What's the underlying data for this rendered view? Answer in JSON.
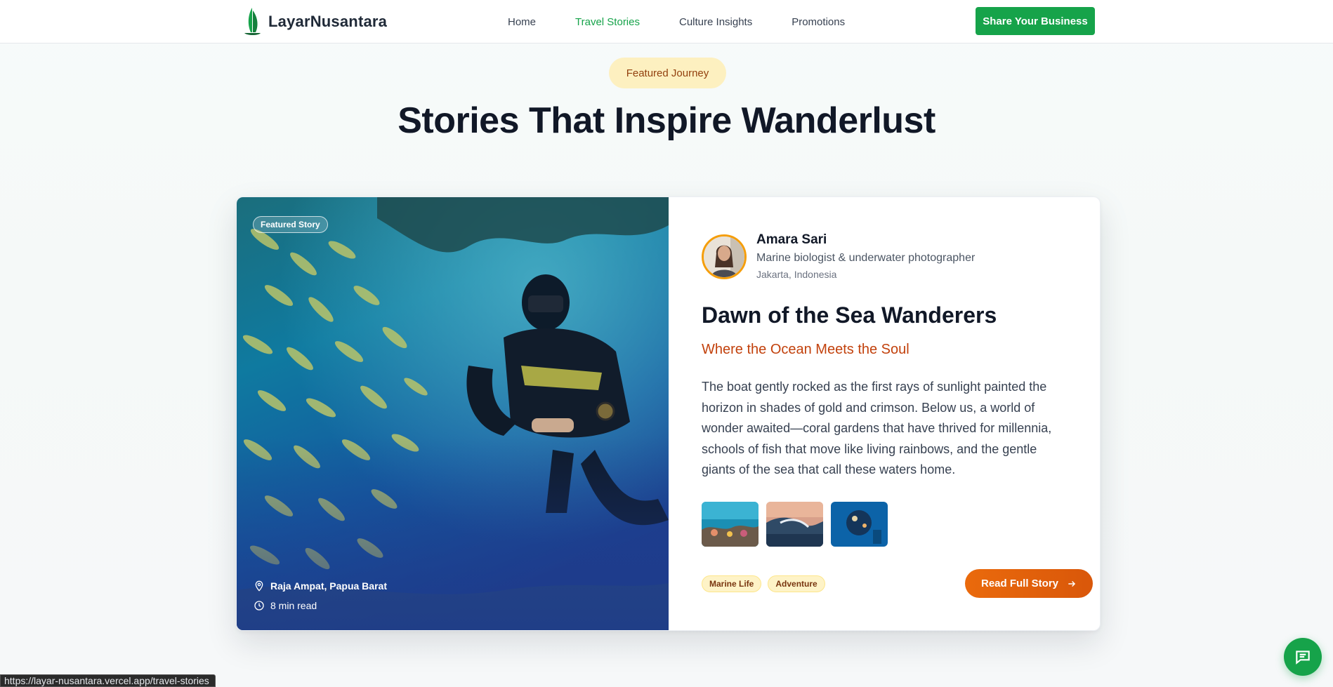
{
  "navbar": {
    "brand": "LayarNusantara",
    "logo_icon": "sailboat-icon",
    "links": [
      {
        "label": "Home",
        "active": false
      },
      {
        "label": "Travel Stories",
        "active": true
      },
      {
        "label": "Culture Insights",
        "active": false
      },
      {
        "label": "Promotions",
        "active": false
      }
    ],
    "cta_label": "Share Your Business"
  },
  "hero": {
    "pill": "Featured Journey",
    "title": "Stories That Inspire Wanderlust"
  },
  "featured_story": {
    "image_badge": "Featured Story",
    "location": "Raja Ampat, Papua Barat",
    "location_icon": "map-pin-icon",
    "read_time": "8 min read",
    "read_time_icon": "clock-icon",
    "author": {
      "name": "Amara Sari",
      "role": "Marine biologist & underwater photographer",
      "location": "Jakarta, Indonesia"
    },
    "title": "Dawn of the Sea Wanderers",
    "subtitle": "Where the Ocean Meets the Soul",
    "excerpt": "The boat gently rocked as the first rays of sunlight painted the horizon in shades of gold and crimson. Below us, a world of wonder awaited—coral gardens that have thrived for millennia, schools of fish that move like living rainbows, and the gentle giants of the sea that call these waters home.",
    "thumbnails": [
      "coral-reef-thumbnail",
      "ocean-wave-thumbnail",
      "diver-reef-thumbnail"
    ],
    "tags": [
      "Marine Life",
      "Adventure"
    ],
    "read_more_label": "Read Full Story",
    "read_more_icon": "arrow-right-icon"
  },
  "chat_icon": "chat-bubble-icon",
  "status_bar_url": "https://layar-nusantara.vercel.app/travel-stories",
  "colors": {
    "brand_green": "#16a34a",
    "accent_orange": "#ea6a0c",
    "subtitle_orange": "#c2410c",
    "pill_bg": "#fdf0c0",
    "tag_bg": "#fef3c7"
  }
}
